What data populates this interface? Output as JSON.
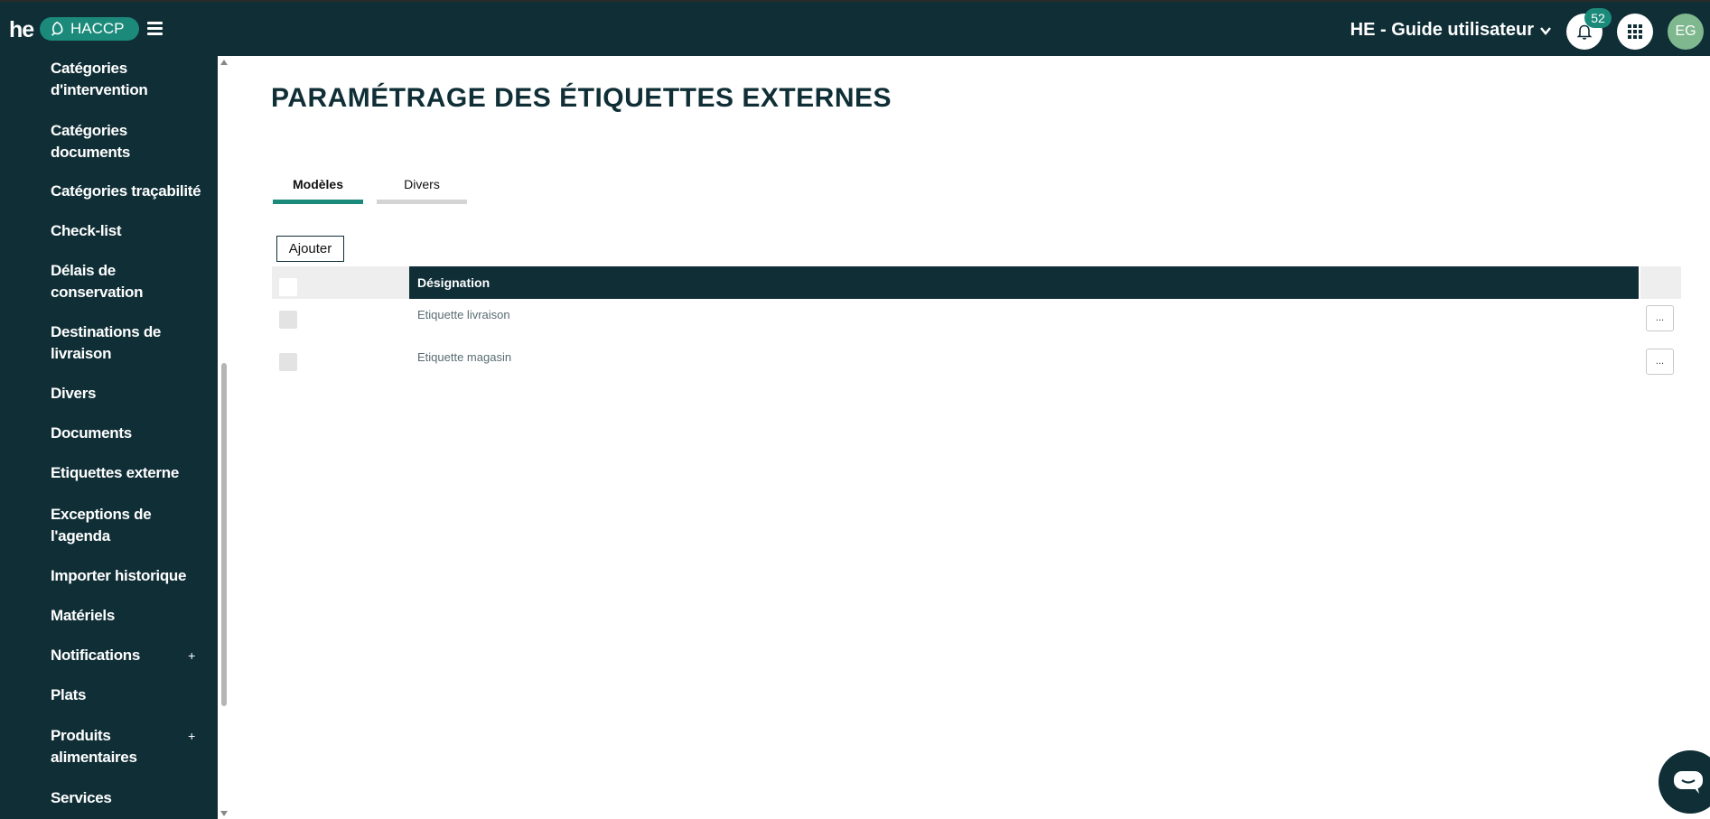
{
  "header": {
    "logo_text": "he",
    "app_name": "HACCP",
    "site_selector": "HE - Guide utilisateur",
    "notification_count": "52",
    "avatar_initials": "EG",
    "icons": [
      "menu-icon",
      "chevron-down-icon",
      "bell-icon",
      "apps-grid-icon",
      "leaf-icon"
    ]
  },
  "sidebar": {
    "items": [
      {
        "label": "Catégories d'intervention",
        "line1": "Catégories",
        "line2": "d'intervention"
      },
      {
        "label": "Catégories documents",
        "line1": "Catégories",
        "line2": "documents"
      },
      {
        "label": "Catégories traçabilité",
        "line1": "Catégories traçabilité",
        "line2": ""
      },
      {
        "label": "Check-list",
        "line1": "Check-list",
        "line2": ""
      },
      {
        "label": "Délais de conservation",
        "line1": "Délais de",
        "line2": "conservation"
      },
      {
        "label": "Destinations de livraison",
        "line1": "Destinations de",
        "line2": "livraison"
      },
      {
        "label": "Divers",
        "line1": "Divers",
        "line2": ""
      },
      {
        "label": "Documents",
        "line1": "Documents",
        "line2": ""
      },
      {
        "label": "Etiquettes externe",
        "line1": "Etiquettes externe",
        "line2": ""
      },
      {
        "label": "Exceptions de l'agenda",
        "line1": "Exceptions de",
        "line2": "l'agenda"
      },
      {
        "label": "Importer historique",
        "line1": "Importer historique",
        "line2": ""
      },
      {
        "label": "Matériels",
        "line1": "Matériels",
        "line2": ""
      },
      {
        "label": "Notifications",
        "line1": "Notifications",
        "line2": "",
        "expand": "+"
      },
      {
        "label": "Plats",
        "line1": "Plats",
        "line2": ""
      },
      {
        "label": "Produits alimentaires",
        "line1": "Produits",
        "line2": "alimentaires",
        "expand": "+"
      },
      {
        "label": "Services",
        "line1": "Services",
        "line2": ""
      }
    ]
  },
  "main": {
    "title": "PARAMÉTRAGE DES ÉTIQUETTES EXTERNES",
    "tabs": [
      {
        "label": "Modèles",
        "active": true
      },
      {
        "label": "Divers",
        "active": false
      }
    ],
    "add_button": "Ajouter",
    "grid": {
      "column_header": "Désignation",
      "rows": [
        {
          "designation": "Etiquette livraison",
          "actions": "..."
        },
        {
          "designation": "Etiquette magasin",
          "actions": "..."
        }
      ]
    }
  },
  "colors": {
    "primary_dark": "#0f2e36",
    "accent_green": "#1b8a7a",
    "avatar_bg": "#7fb88f"
  }
}
